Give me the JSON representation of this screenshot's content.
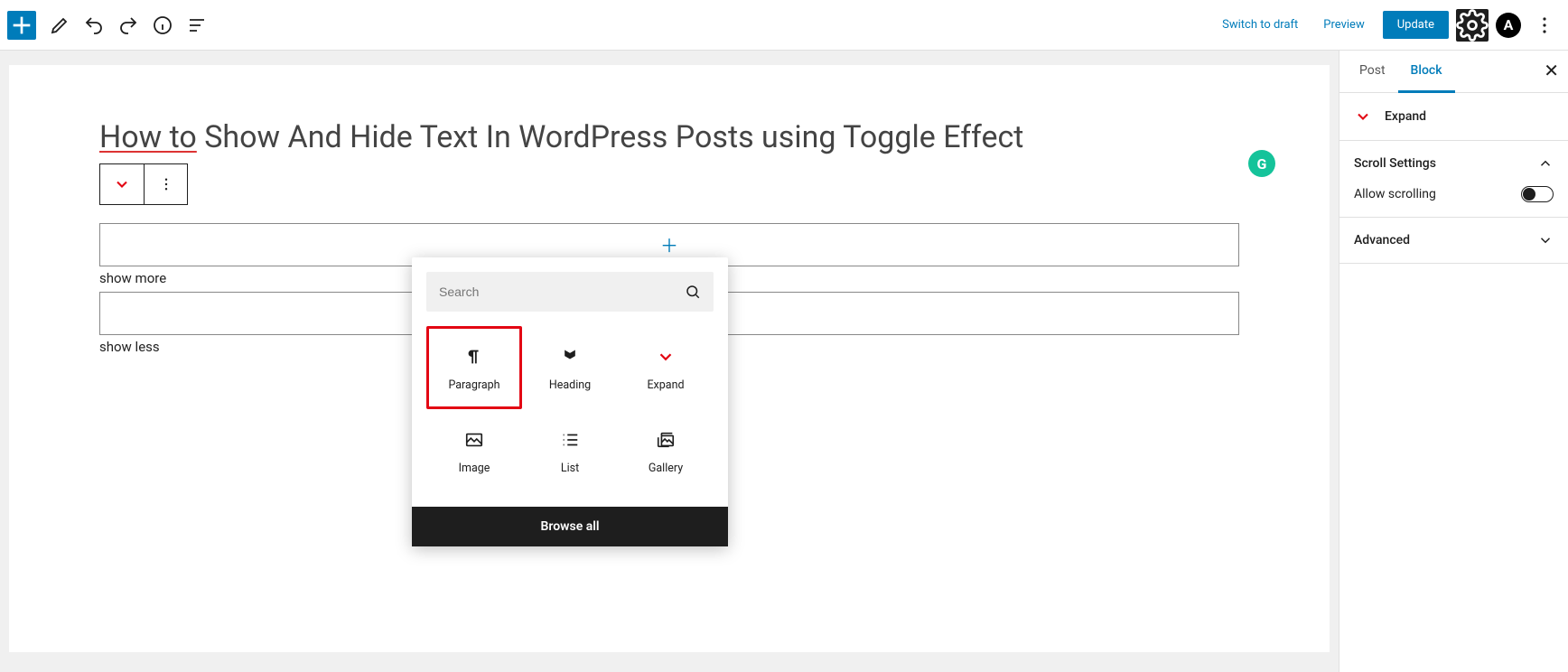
{
  "toolbar": {
    "switch_draft": "Switch to draft",
    "preview": "Preview",
    "update": "Update"
  },
  "post": {
    "title_underlined": "How to",
    "title_rest": " Show And Hide Text In WordPress Posts using Toggle Effect",
    "show_more": "show more",
    "show_less": "show less"
  },
  "inserter": {
    "search_placeholder": "Search",
    "blocks": [
      {
        "label": "Paragraph"
      },
      {
        "label": "Heading"
      },
      {
        "label": "Expand"
      },
      {
        "label": "Image"
      },
      {
        "label": "List"
      },
      {
        "label": "Gallery"
      }
    ],
    "browse_all": "Browse all"
  },
  "sidebar": {
    "tabs": {
      "post": "Post",
      "block": "Block"
    },
    "block_name": "Expand",
    "scroll_settings": "Scroll Settings",
    "allow_scrolling": "Allow scrolling",
    "advanced": "Advanced"
  }
}
